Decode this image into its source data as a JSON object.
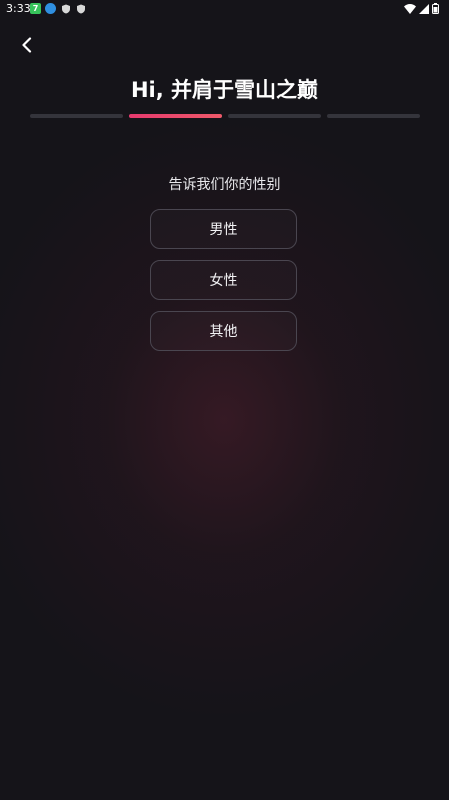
{
  "status_bar": {
    "time": "3:33",
    "green_app_badge": "7"
  },
  "header": {
    "title": "Hi, 并肩于雪山之巅"
  },
  "progress": {
    "current_step": 2,
    "total_steps": 4
  },
  "question": {
    "prompt": "告诉我们你的性别",
    "options": [
      "男性",
      "女性",
      "其他"
    ]
  },
  "colors": {
    "background": "#151419",
    "accent": "#e63a6e"
  }
}
